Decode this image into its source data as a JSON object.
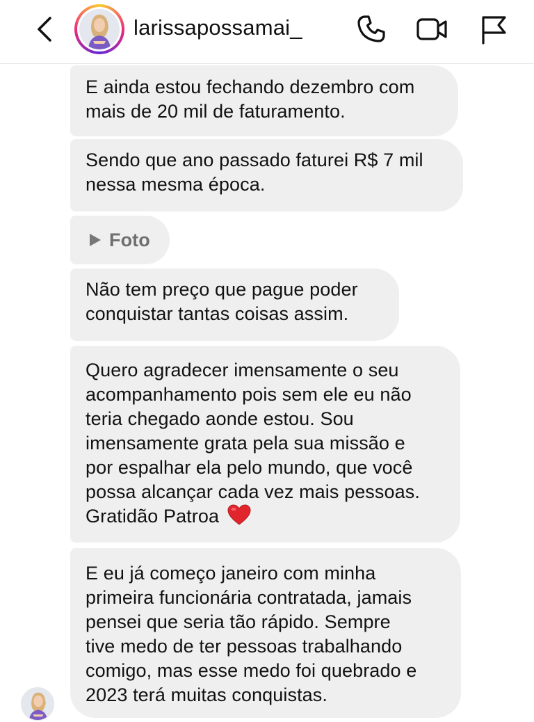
{
  "header": {
    "username": "larissapossamai_",
    "icons": [
      "back-chevron-icon",
      "phone-icon",
      "video-camera-icon",
      "flag-icon"
    ]
  },
  "messages": [
    {
      "lines": [
        "E ainda estou fechando dezembro com",
        "mais de 20 mil de faturamento."
      ]
    },
    {
      "lines": [
        "Sendo que ano passado faturei R$ 7 mil",
        "nessa mesma época."
      ]
    },
    {
      "type": "photo",
      "label": "Foto"
    },
    {
      "lines": [
        "Não tem preço que pague poder",
        "conquistar tantas coisas assim."
      ]
    },
    {
      "lines": [
        "Quero agradecer imensamente o seu",
        "acompanhamento pois sem ele eu não",
        "teria chegado aonde estou. Sou",
        "imensamente grata pela sua missão e",
        "por espalhar ela pelo mundo, que você",
        "possa alcançar cada vez mais pessoas.",
        "Gratidão Patroa"
      ],
      "emoji": "heart-icon"
    },
    {
      "lines": [
        "E eu já começo janeiro com minha",
        "primeira funcionária contratada, jamais",
        "pensei que seria tão rápido. Sempre",
        "tive medo de ter pessoas trabalhando",
        "comigo, mas esse medo foi quebrado e",
        "2023 terá muitas conquistas."
      ]
    }
  ],
  "colors": {
    "bubble": "#efefef",
    "text": "#111111",
    "heart": "#e0252d"
  }
}
